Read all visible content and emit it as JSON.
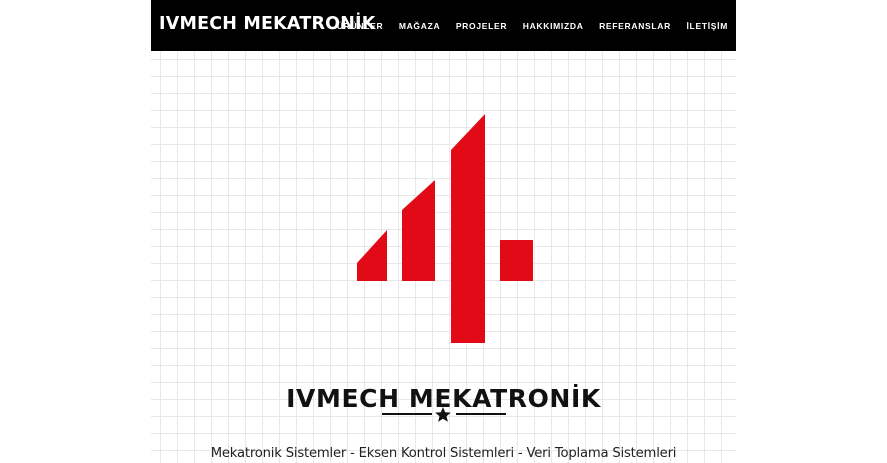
{
  "header": {
    "brand": "IVMECH MEKATRONİK",
    "nav": [
      {
        "label": "ÜRÜNLER"
      },
      {
        "label": "MAĞAZA"
      },
      {
        "label": "PROJELER"
      },
      {
        "label": "HAKKIMIZDA"
      },
      {
        "label": "REFERANSLAR"
      },
      {
        "label": "İLETİŞİM"
      }
    ]
  },
  "hero": {
    "logo_icon": "ivmech-4-logo-icon",
    "title": "IVMECH MEKATRONİK",
    "divider_icon": "star-icon",
    "tagline": "Mekatronik Sistemler - Eksen Kontrol Sistemleri - Veri Toplama Sistemleri"
  },
  "colors": {
    "brand_red": "#E20A17",
    "navbar_bg": "#000000",
    "grid_line": "#E8E8E8"
  }
}
